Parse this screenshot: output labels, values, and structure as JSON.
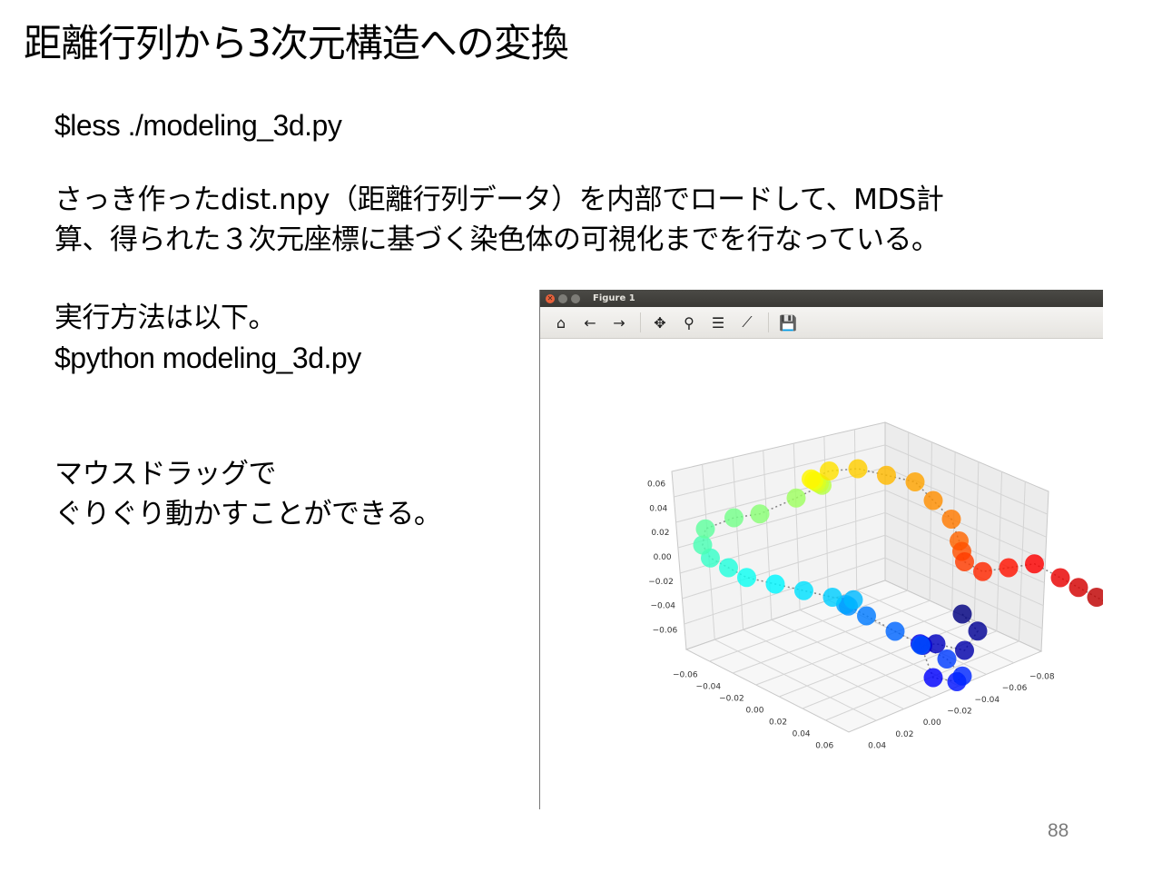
{
  "slide": {
    "title": "距離行列から3次元構造への変換",
    "command1": "$less ./modeling_3d.py",
    "desc_line1": "さっき作ったdist.npy（距離行列データ）を内部でロードして、MDS計",
    "desc_line2": "算、得られた３次元座標に基づく染色体の可視化までを行なっている。",
    "method_line1": "実行方法は以下。",
    "method_line2": "$python modeling_3d.py",
    "mouse_line1": "マウスドラッグで",
    "mouse_line2": "ぐりぐり動かすことができる。",
    "page_number": "88"
  },
  "figure_window": {
    "title": "Figure 1",
    "close_glyph": "✕",
    "toolbar_icons": [
      "home-icon",
      "back-arrow-icon",
      "forward-arrow-icon",
      "pan-icon",
      "zoom-icon",
      "subplots-config-icon",
      "edit-axes-icon",
      "save-icon"
    ],
    "toolbar_glyphs": [
      "⌂",
      "←",
      "→",
      "✥",
      "⚲",
      "☰",
      "⟋",
      "💾"
    ]
  },
  "chart_data": {
    "type": "scatter",
    "title": "",
    "z_tick_labels": [
      "0.06",
      "0.04",
      "0.02",
      "0.00",
      "−0.02",
      "−0.04",
      "−0.06"
    ],
    "x_tick_labels": [
      "−0.06",
      "−0.04",
      "−0.02",
      "0.00",
      "0.02",
      "0.04",
      "0.06"
    ],
    "y_tick_labels": [
      "0.04",
      "0.02",
      "0.00",
      "−0.02",
      "−0.04",
      "−0.06",
      "−0.08"
    ],
    "point_count": 50,
    "colormap": "jet",
    "series": [
      {
        "points": [
          [
            0.0,
            -0.05,
            -0.04
          ],
          [
            0.01,
            -0.05,
            -0.045
          ],
          [
            0.015,
            -0.04,
            -0.05
          ],
          [
            0.01,
            -0.03,
            -0.045
          ],
          [
            0.015,
            -0.02,
            -0.04
          ],
          [
            0.02,
            -0.015,
            -0.035
          ],
          [
            0.015,
            -0.025,
            -0.06
          ],
          [
            0.01,
            -0.04,
            -0.07
          ],
          [
            0.0,
            -0.05,
            -0.075
          ],
          [
            -0.01,
            -0.05,
            -0.07
          ],
          [
            -0.02,
            -0.045,
            -0.065
          ],
          [
            -0.03,
            -0.04,
            -0.06
          ],
          [
            -0.035,
            -0.03,
            -0.05
          ],
          [
            -0.04,
            -0.025,
            -0.045
          ],
          [
            -0.035,
            -0.02,
            -0.04
          ],
          [
            -0.03,
            -0.02,
            -0.035
          ],
          [
            -0.03,
            -0.01,
            -0.03
          ],
          [
            -0.035,
            0.0,
            -0.025
          ],
          [
            -0.04,
            0.01,
            -0.02
          ],
          [
            -0.045,
            0.02,
            -0.015
          ],
          [
            -0.05,
            0.025,
            -0.01
          ],
          [
            -0.055,
            0.03,
            -0.005
          ],
          [
            -0.06,
            0.03,
            0.0
          ],
          [
            -0.065,
            0.025,
            0.005
          ],
          [
            -0.06,
            0.015,
            0.01
          ],
          [
            -0.05,
            0.01,
            0.015
          ],
          [
            -0.04,
            0.0,
            0.025
          ],
          [
            -0.03,
            -0.005,
            0.035
          ],
          [
            -0.025,
            0.0,
            0.04
          ],
          [
            -0.02,
            0.005,
            0.045
          ],
          [
            -0.015,
            0.01,
            0.05
          ],
          [
            -0.01,
            0.015,
            0.055
          ],
          [
            -0.005,
            0.01,
            0.06
          ],
          [
            0.0,
            0.0,
            0.06
          ],
          [
            0.005,
            -0.01,
            0.055
          ],
          [
            0.01,
            -0.02,
            0.05
          ],
          [
            0.015,
            -0.025,
            0.04
          ],
          [
            0.02,
            -0.03,
            0.03
          ],
          [
            0.025,
            -0.03,
            0.02
          ],
          [
            0.02,
            -0.035,
            0.01
          ],
          [
            0.015,
            -0.04,
            0.0
          ],
          [
            0.02,
            -0.045,
            -0.005
          ],
          [
            0.03,
            -0.05,
            0.0
          ],
          [
            0.04,
            -0.055,
            0.005
          ],
          [
            0.05,
            -0.06,
            0.0
          ],
          [
            0.055,
            -0.065,
            -0.005
          ],
          [
            0.06,
            -0.07,
            -0.01
          ],
          [
            0.065,
            -0.075,
            -0.015
          ],
          [
            0.07,
            -0.08,
            -0.02
          ],
          [
            0.075,
            -0.085,
            -0.025
          ]
        ]
      }
    ]
  }
}
